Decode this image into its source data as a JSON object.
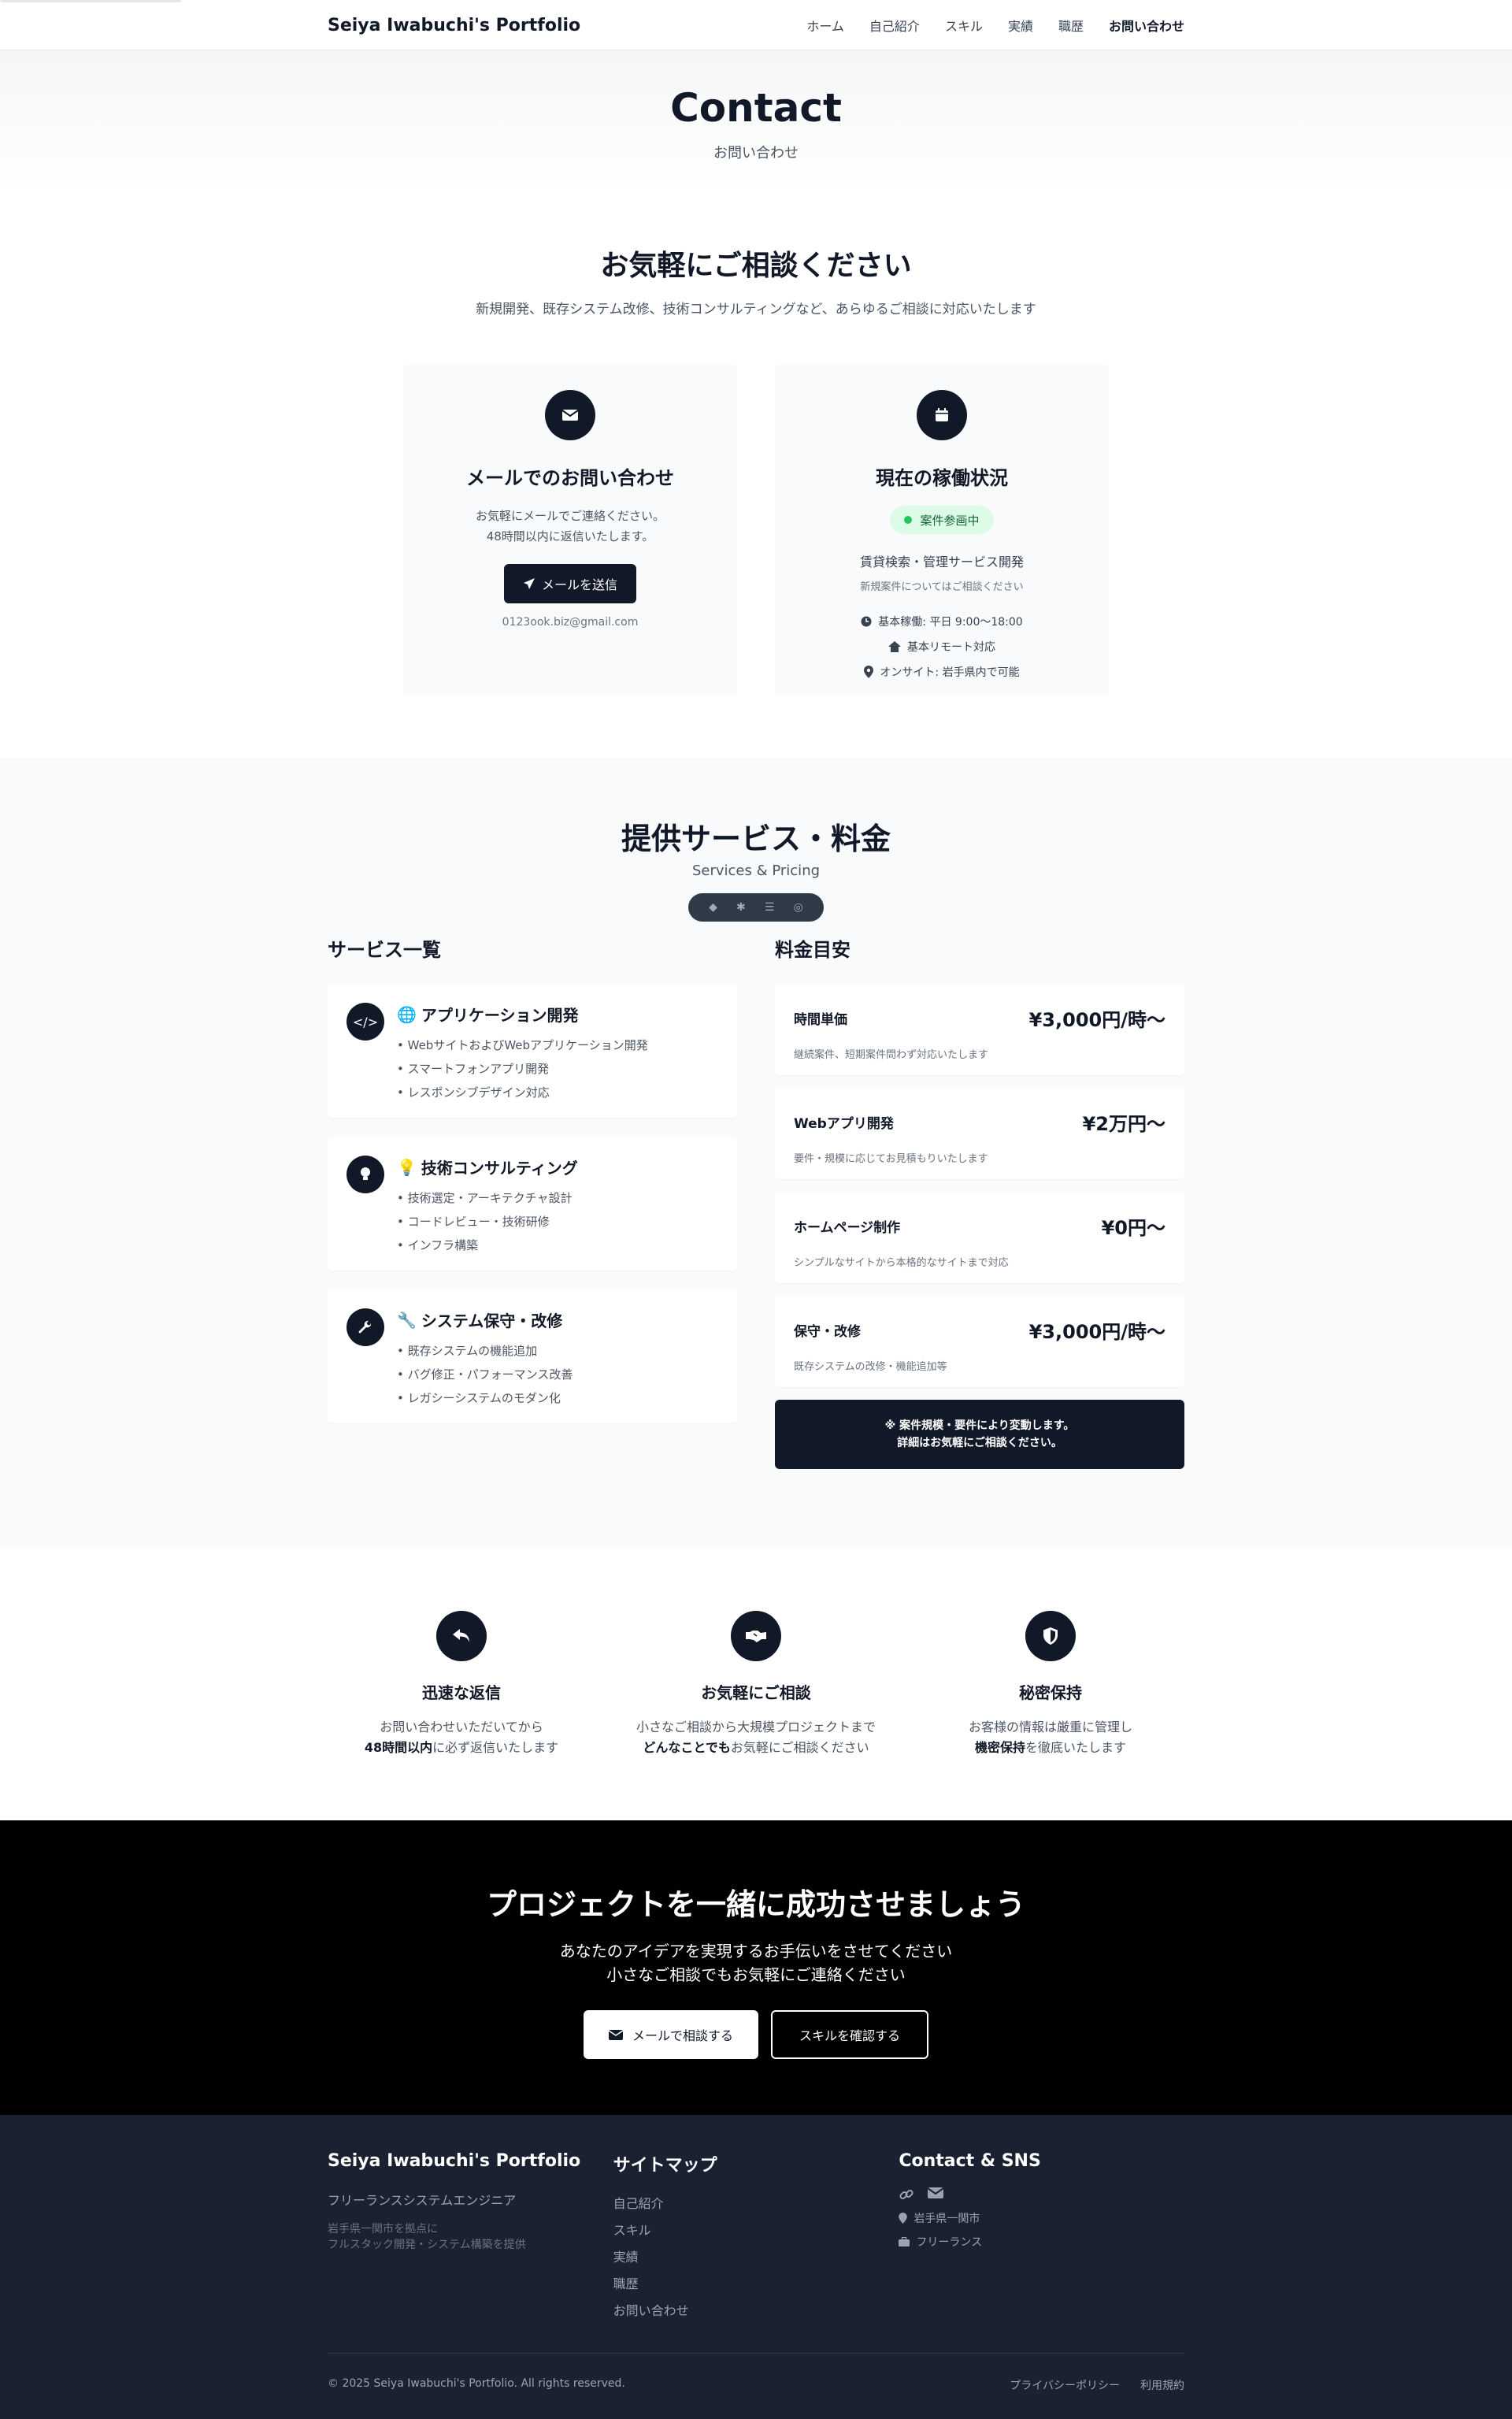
{
  "header": {
    "brand": "Seiya Iwabuchi's Portfolio",
    "nav": [
      "ホーム",
      "自己紹介",
      "スキル",
      "実績",
      "職歴",
      "お問い合わせ"
    ]
  },
  "hero": {
    "title": "Contact",
    "subtitle": "お問い合わせ"
  },
  "consult": {
    "title": "お気軽にご相談ください",
    "lead": "新規開発、既存システム改修、技術コンサルティングなど、あらゆるご相談に対応いたします",
    "email_card": {
      "title": "メールでのお問い合わせ",
      "desc1": "お気軽にメールでご連絡ください。",
      "desc2": "48時間以内に返信いたします。",
      "button": "メールを送信",
      "email": "0123ook.biz@gmail.com"
    },
    "status_card": {
      "title": "現在の稼働状況",
      "badge": "案件参画中",
      "work_title": "賃貸検索・管理サービス開発",
      "work_sub": "新規案件についてはご相談ください",
      "hours": "基本稼働: 平日 9:00〜18:00",
      "remote": "基本リモート対応",
      "onsite": "オンサイト: 岩手県内で可能"
    }
  },
  "services": {
    "title": "提供サービス・料金",
    "subtitle": "Services & Pricing",
    "list_title": "サービス一覧",
    "items": [
      {
        "emoji": "🌐",
        "title": "アプリケーション開発",
        "points": [
          "• WebサイトおよびWebアプリケーション開発",
          "• スマートフォンアプリ開発",
          "• レスポンシブデザイン対応"
        ]
      },
      {
        "emoji": "💡",
        "title": "技術コンサルティング",
        "points": [
          "• 技術選定・アーキテクチャ設計",
          "• コードレビュー・技術研修",
          "• インフラ構築"
        ]
      },
      {
        "emoji": "🔧",
        "title": "システム保守・改修",
        "points": [
          "• 既存システムの機能追加",
          "• バグ修正・パフォーマンス改善",
          "• レガシーシステムのモダン化"
        ]
      }
    ],
    "pricing_title": "料金目安",
    "pricing": [
      {
        "name": "時間単価",
        "price": "¥3,000円/時〜",
        "note": "継続案件、短期案件問わず対応いたします"
      },
      {
        "name": "Webアプリ開発",
        "price": "¥2万円〜",
        "note": "要件・規模に応じてお見積もりいたします"
      },
      {
        "name": "ホームページ制作",
        "price": "¥0円〜",
        "note": "シンプルなサイトから本格的なサイトまで対応"
      },
      {
        "name": "保守・改修",
        "price": "¥3,000円/時〜",
        "note": "既存システムの改修・機能追加等"
      }
    ],
    "pricing_footer1": "※ 案件規模・要件により変動します。",
    "pricing_footer2": "詳細はお気軽にご相談ください。"
  },
  "features": [
    {
      "title": "迅速な返信",
      "line1": "お問い合わせいただいてから",
      "line2_bold": "48時間以内",
      "line2_rest": "に必ず返信いたします"
    },
    {
      "title": "お気軽にご相談",
      "line1": "小さなご相談から大規模プロジェクトまで",
      "line2_bold": "どんなことでも",
      "line2_rest": "お気軽にご相談ください"
    },
    {
      "title": "秘密保持",
      "line1": "お客様の情報は厳重に管理し",
      "line2_bold": "機密保持",
      "line2_rest": "を徹底いたします"
    }
  ],
  "cta": {
    "title": "プロジェクトを一緒に成功させましょう",
    "line1": "あなたのアイデアを実現するお手伝いをさせてください",
    "line2": "小さなご相談でもお気軽にご連絡ください",
    "primary": "メールで相談する",
    "secondary": "スキルを確認する"
  },
  "footer": {
    "brand": "Seiya Iwabuchi's Portfolio",
    "role": "フリーランスシステムエンジニア",
    "desc1": "岩手県一関市を拠点に",
    "desc2": "フルスタック開発・システム構築を提供",
    "sitemap_title": "サイトマップ",
    "sitemap": [
      "自己紹介",
      "スキル",
      "実績",
      "職歴",
      "お問い合わせ"
    ],
    "contact_title": "Contact & SNS",
    "location": "岩手県一関市",
    "status": "フリーランス",
    "copyright": "© 2025 Seiya Iwabuchi's Portfolio. All rights reserved.",
    "privacy": "プライバシーポリシー",
    "terms": "利用規約"
  }
}
